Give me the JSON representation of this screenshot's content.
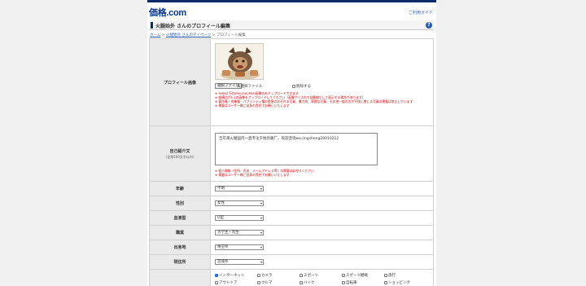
{
  "site": {
    "logo": "価格.com",
    "help": "ご利用ガイド"
  },
  "header": {
    "title": "火腿始外 さんのプロフィール編集",
    "help_icon": "?"
  },
  "breadcrumb": {
    "home": "ホーム",
    "sep1": " > ",
    "mypage": "火腿始外 さんのマイページ",
    "sep2": " > ",
    "current": "プロフィール編集"
  },
  "profile_image": {
    "label": "プロフィール画像",
    "file_button": "選択ファイル",
    "no_file": "未選択ファイル",
    "delete_label": "削除する",
    "notes": [
      "※ 5MB以下のJPEG/GIF/PNG画像のみアップロードできます",
      "※ 縦横比が1:1の画像をアップロードしてください（画像サイズ内で自動縮小して表示する場合があります）",
      "※ 著作権・肖像権・パブリシティ権の侵害のおそれる写真、暴力的、卑猥な写真、その他一般の方が不快に感じる写真の掲載は禁止しています",
      "※ 掲載はユーザー様ご自身の責任でお願いいたします"
    ]
  },
  "self_intro": {
    "label": "自己紹介文",
    "sublabel": "（全角500文字以内）",
    "value": "吉年来火腿国内一直专注于始外腿厂。欢迎咨询wx:jingcheng20010212",
    "notes": [
      "※ 個人情報（住所、氏名、メールアドレス等）の掲載はお控えください",
      "※ 掲載はユーザー様ご自身の責任でお願いいたします"
    ]
  },
  "fields": [
    {
      "key": "age",
      "label": "年齢",
      "value": "不明"
    },
    {
      "key": "gender",
      "label": "性別",
      "value": "女性"
    },
    {
      "key": "blood",
      "label": "血液型",
      "value": "O型"
    },
    {
      "key": "job",
      "label": "職業",
      "value": "大学生・院生"
    },
    {
      "key": "birthplace",
      "label": "出身地",
      "value": "埼玉県"
    },
    {
      "key": "residence",
      "label": "現住所",
      "value": "宮城県"
    }
  ],
  "hobbies": {
    "items": [
      {
        "label": "インターネット",
        "checked": true
      },
      {
        "label": "カメラ",
        "checked": false
      },
      {
        "label": "スポーツ",
        "checked": false
      },
      {
        "label": "スポーツ観戦",
        "checked": false
      },
      {
        "label": "旅行",
        "checked": false
      },
      {
        "label": "アウトドア",
        "checked": false
      },
      {
        "label": "クルマ",
        "checked": false
      },
      {
        "label": "バイク",
        "checked": false
      },
      {
        "label": "自転車",
        "checked": false
      },
      {
        "label": "ショッピング",
        "checked": false
      },
      {
        "label": "",
        "checked": false
      },
      {
        "label": "",
        "checked": false
      },
      {
        "label": "",
        "checked": false
      },
      {
        "label": "",
        "checked": false
      },
      {
        "label": "",
        "checked": false
      }
    ]
  },
  "colors": {
    "accent": "#0a2a6e",
    "link": "#2a5db0",
    "warning": "#cc0000"
  }
}
